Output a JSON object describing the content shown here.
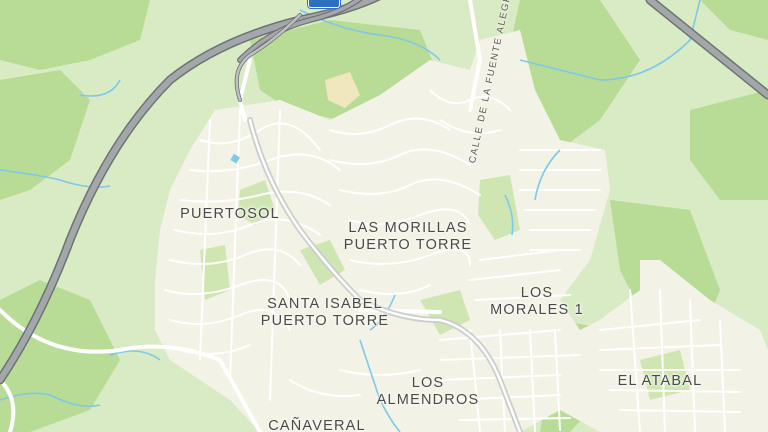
{
  "map": {
    "colors": {
      "land": "#d9ebc4",
      "forest": "#b8dc95",
      "urban": "#f3f2e6",
      "urban_block": "#e6e6dc",
      "street": "#ffffff",
      "highway": "#8f9294",
      "highway_casing": "#6f7275",
      "river": "#7ec8e8",
      "sand": "#f0e7bf",
      "label": "#4a4a4a",
      "shield": "#2e6fc4"
    },
    "places": {
      "puertosol": "PUERTOSOL",
      "las_morillas_1": "LAS MORILLAS",
      "las_morillas_2": "PUERTO TORRE",
      "santa_isabel_1": "SANTA ISABEL",
      "santa_isabel_2": "PUERTO TORRE",
      "los_morales_1": "LOS",
      "los_morales_2": "MORALES 1",
      "los_almendros_1": "LOS",
      "los_almendros_2": "ALMENDROS",
      "el_atabal": "EL ATABAL",
      "canaveral": "CAÑAVERAL"
    },
    "streets": {
      "calle_fuente_alegre": "CALLE DE LA FUENTE ALEGRE"
    },
    "icons": {
      "highway_shield": "highway-shield-icon",
      "water_marker": "water-icon"
    }
  }
}
